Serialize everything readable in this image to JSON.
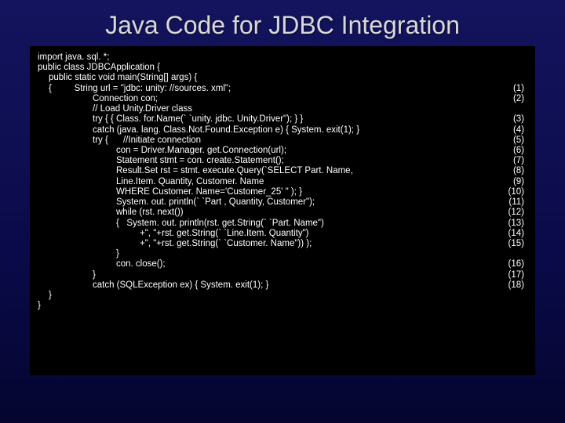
{
  "title": "Java Code for JDBC Integration",
  "code": [
    {
      "indent": "",
      "text": "import java. sql. *;",
      "num": ""
    },
    {
      "indent": "",
      "text": "public class JDBCApplication {",
      "num": ""
    },
    {
      "indent": "i1",
      "text": "public static void main(String[] args) {",
      "num": ""
    },
    {
      "indent": "i1",
      "text": "{         String url = \"jdbc: unity: //sources. xml\";",
      "num": "(1)"
    },
    {
      "indent": "i3",
      "text": "Connection con;",
      "num": "(2)"
    },
    {
      "indent": "i3",
      "text": "// Load Unity.Driver class",
      "num": ""
    },
    {
      "indent": "i3",
      "text": "try { { Class. for.Name(` `unity. jdbc. Unity.Driver\"); } }",
      "num": "(3)"
    },
    {
      "indent": "i3",
      "text": "catch (java. lang. Class.Not.Found.Exception e) { System. exit(1); }",
      "num": "(4)"
    },
    {
      "indent": "i3",
      "text": "try {      //Initiate connection",
      "num": "(5)"
    },
    {
      "indent": "i4",
      "text": "con = Driver.Manager. get.Connection(url);",
      "num": "(6)"
    },
    {
      "indent": "i4",
      "text": "Statement stmt = con. create.Statement();",
      "num": "(7)"
    },
    {
      "indent": "i4",
      "text": "Result.Set rst = stmt. execute.Query(`SELECT Part. Name,",
      "num": "(8)"
    },
    {
      "indent": "i4",
      "text": "Line.Item. Quantity, Customer. Name",
      "num": "(9)"
    },
    {
      "indent": "i4",
      "text": "WHERE Customer. Name='Customer_25' \" ); }",
      "num": "(10)"
    },
    {
      "indent": "i4",
      "text": "System. out. println(` `Part , Quantity, Customer\");",
      "num": "(11)"
    },
    {
      "indent": "i4",
      "text": "while (rst. next())",
      "num": "(12)"
    },
    {
      "indent": "i4",
      "text": "{   System. out. println(rst. get.String(` `Part. Name\")",
      "num": "(13)"
    },
    {
      "indent": "i5",
      "text": "+\", \"+rst. get.String(` `Line.Item. Quantity\")",
      "num": "(14)"
    },
    {
      "indent": "i5",
      "text": "+\", \"+rst. get.String(` `Customer. Name\")) );",
      "num": "(15)"
    },
    {
      "indent": "i4",
      "text": "}",
      "num": ""
    },
    {
      "indent": "i4",
      "text": "con. close();",
      "num": "(16)"
    },
    {
      "indent": "i3",
      "text": "}",
      "num": "(17)"
    },
    {
      "indent": "i3",
      "text": "catch (SQLException ex) { System. exit(1); }",
      "num": "(18)"
    },
    {
      "indent": "i1",
      "text": "}",
      "num": ""
    },
    {
      "indent": "",
      "text": "}",
      "num": ""
    }
  ]
}
